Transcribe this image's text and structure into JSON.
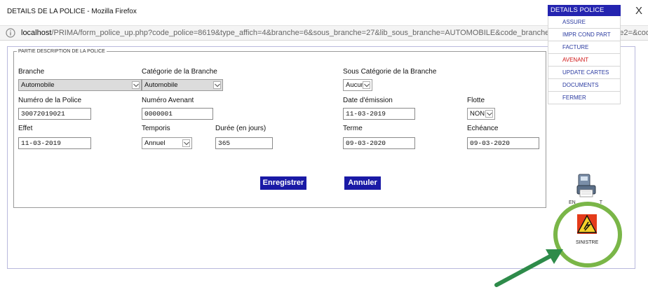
{
  "window": {
    "title": "DETAILS DE LA POLICE - Mozilla Firefox",
    "close": "X"
  },
  "address": {
    "host": "localhost",
    "path": "/PRIMA/form_police_up.php?code_police=8619&type_affich=4&branche=6&sous_branche=27&lib_sous_branche=AUTOMOBILE&code_branche2=&lib_sous_branche2=&code_client=11077&cod"
  },
  "form": {
    "legend": "PARTIE DESCRIPTION DE LA POLICE",
    "branche": {
      "label": "Branche",
      "value": "Automobile"
    },
    "categorie": {
      "label": "Catégorie de la Branche",
      "value": "Automobile"
    },
    "sous_categorie": {
      "label": "Sous Catégorie de la Branche",
      "value": "Aucun"
    },
    "numero_police": {
      "label": "Numéro de la Police",
      "value": "30072019021"
    },
    "numero_avenant": {
      "label": "Numéro Avenant",
      "value": "0000001"
    },
    "date_emission": {
      "label": "Date d'émission",
      "value": "11-03-2019"
    },
    "flotte": {
      "label": "Flotte",
      "value": "NON"
    },
    "effet": {
      "label": "Effet",
      "value": "11-03-2019"
    },
    "temporis": {
      "label": "Temporis",
      "value": "Annuel"
    },
    "duree": {
      "label": "Durée (en jours)",
      "value": "365"
    },
    "terme": {
      "label": "Terme",
      "value": "09-03-2020"
    },
    "echeance": {
      "label": "Echéance",
      "value": "09-03-2020"
    },
    "save_label": "Enregistrer",
    "cancel_label": "Annuler"
  },
  "sidebar": {
    "header": "DETAILS POLICE",
    "items": [
      {
        "label": "ASSURE"
      },
      {
        "label": "IMPR COND PART"
      },
      {
        "label": "FACTURE"
      },
      {
        "label": "AVENANT"
      },
      {
        "label": "UPDATE CARTES"
      },
      {
        "label": "DOCUMENTS"
      },
      {
        "label": "FERMER"
      }
    ],
    "print_label": "EN",
    "print_label_tail": "T",
    "sinistre_label": "SINISTRE"
  },
  "colors": {
    "accent": "#2424b0",
    "button": "#1a1aa6",
    "active_item": "#d01818",
    "highlight_circle": "#7ab648"
  },
  "icons": {
    "lock": "info-lock-icon",
    "print": "printer-icon",
    "sinistre": "warning-icon",
    "arrow": "arrow-annotation"
  }
}
